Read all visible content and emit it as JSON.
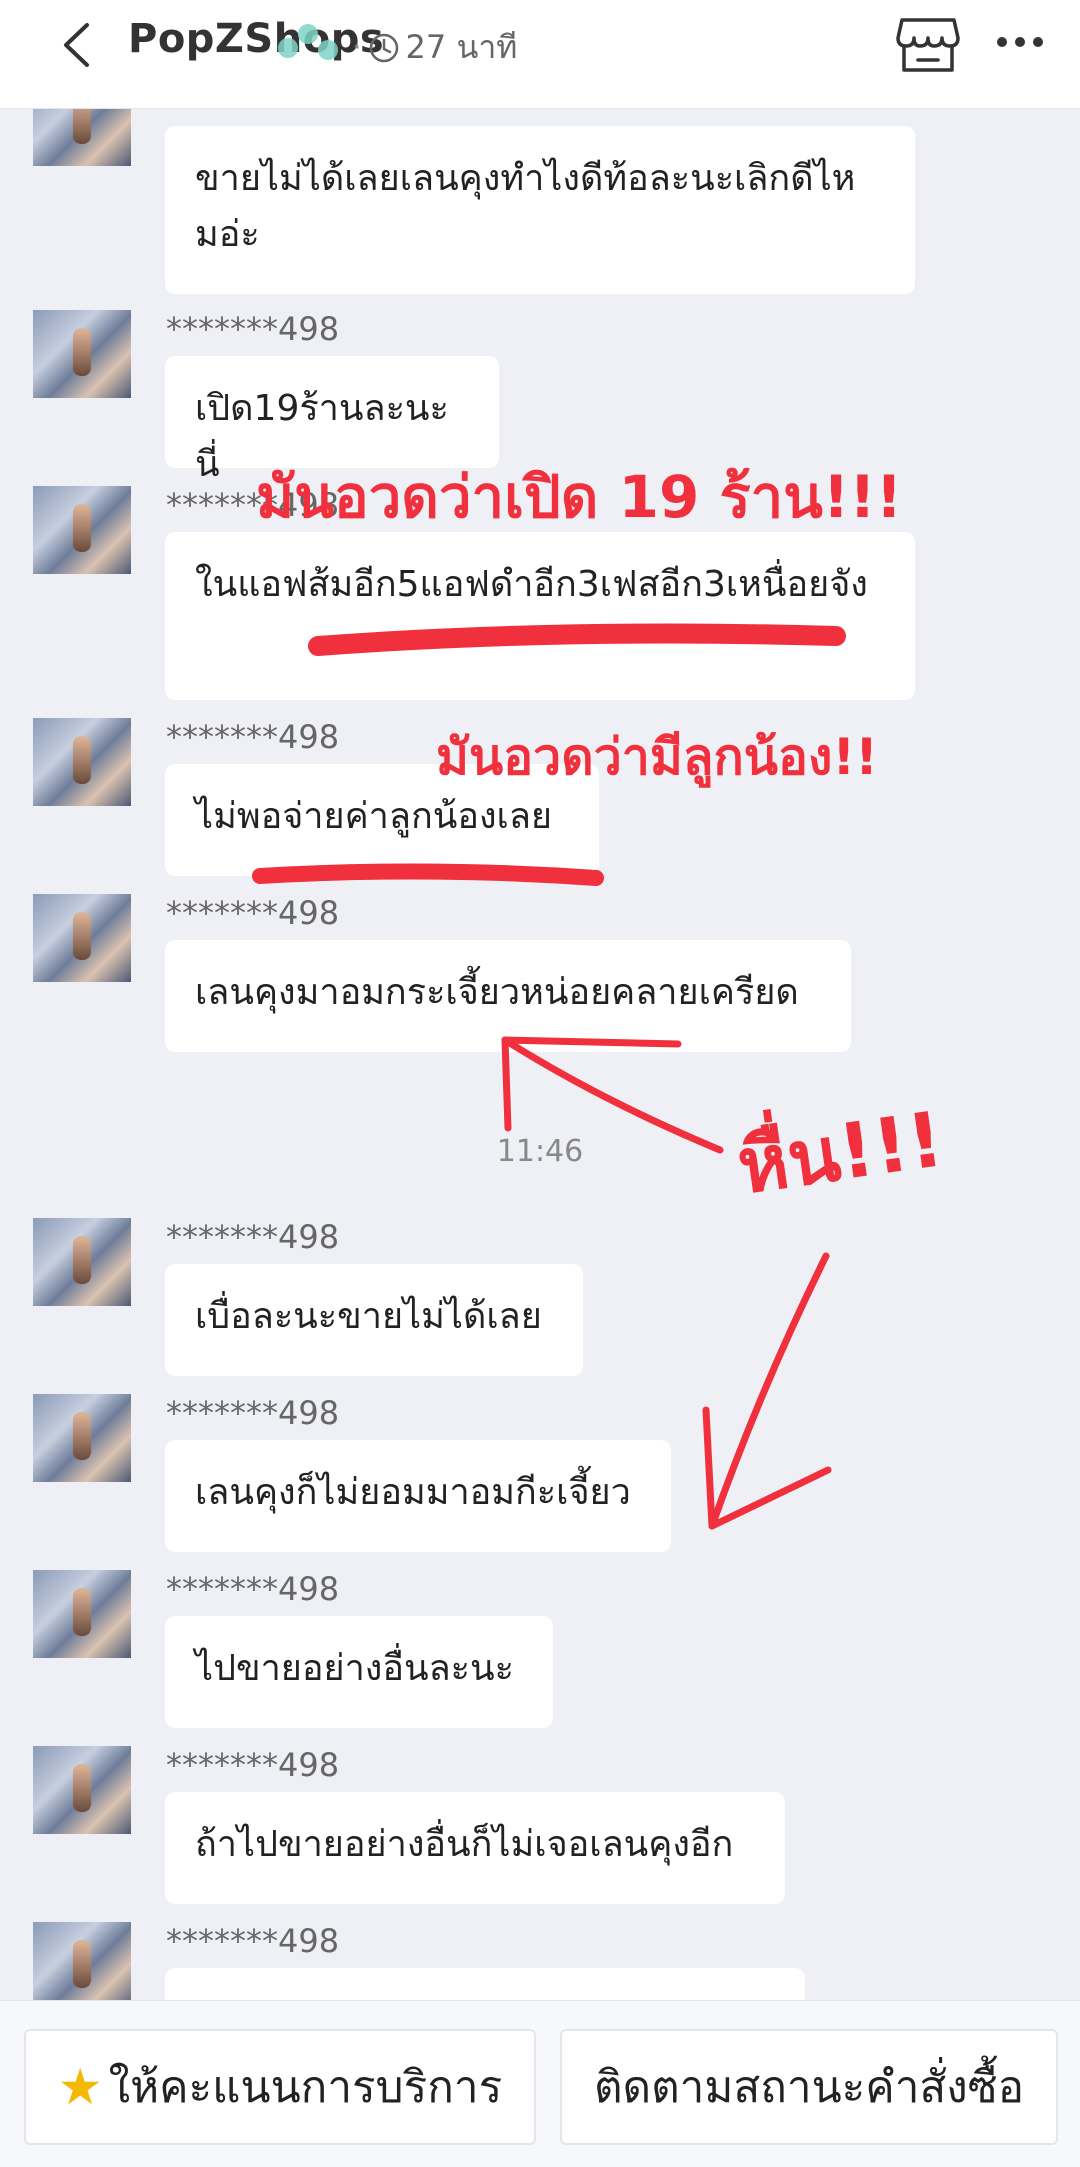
{
  "header": {
    "shop_name": "PopZShops",
    "last_seen": "27 นาที"
  },
  "messages": [
    {
      "text": "ขายไม่ได้เลยเลนคุงทำไงดีท้อละนะเลิกดีไหมอ่ะ"
    },
    {
      "user": "*******498",
      "text": "เปิด19ร้านละนะนี่"
    },
    {
      "user": "*******498",
      "text": "ในแอฟส้มอีก5แอฟดำอีก3เฟสอีก3เหนื่อยจัง"
    },
    {
      "user": "*******498",
      "text": "ไม่พอจ่ายค่าลูกน้องเลย"
    },
    {
      "user": "*******498",
      "text": "เลนคุงมาอมกระเจี้ยวหน่อยคลายเครียด"
    },
    {
      "user": "*******498",
      "text": "เบื่อละนะขายไม่ได้เลย"
    },
    {
      "user": "*******498",
      "text": "เลนคุงก็ไม่ยอมมาอมกีะเจี้ยว"
    },
    {
      "user": "*******498",
      "text": "ไปขายอย่างอื่นละนะ"
    },
    {
      "user": "*******498",
      "text": "ถ้าไปขายอย่างอื่นก็ไม่เจอเลนคุงอีก"
    },
    {
      "user": "*******498",
      "text": ""
    }
  ],
  "timestamp": "11:46",
  "annotations": {
    "a1": "มันอวดว่าเปิด 19 ร้าน!!!",
    "a2": "มันอวดว่ามีลูกน้อง!!",
    "a3": "หื่น!!!",
    "color": "#f0303d"
  },
  "footer": {
    "rate_label": "ให้คะแนนการบริการ",
    "track_label": "ติดตามสถานะคำสั่งซื้อ",
    "rate_icon": "star-icon"
  }
}
